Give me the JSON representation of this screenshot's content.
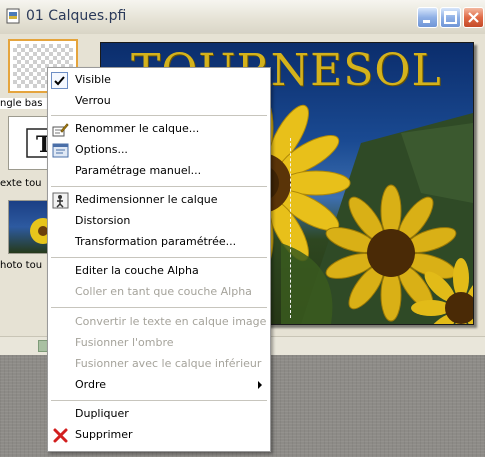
{
  "window": {
    "title": "01 Calques.pfi"
  },
  "layers": [
    {
      "label": "ngle bas"
    },
    {
      "label": "exte tou"
    },
    {
      "label": "hoto tou"
    }
  ],
  "image": {
    "title": "TOURNESOL"
  },
  "menu": {
    "items": [
      {
        "label": "Visible",
        "checked": true,
        "enabled": true
      },
      {
        "label": "Verrou",
        "enabled": true
      },
      {
        "label": "Renommer le calque...",
        "icon": "rename-icon",
        "enabled": true
      },
      {
        "label": "Options...",
        "icon": "options-icon",
        "enabled": true
      },
      {
        "label": "Paramétrage manuel...",
        "enabled": true
      },
      {
        "label": "Redimensionner le calque",
        "icon": "resize-icon",
        "enabled": true
      },
      {
        "label": "Distorsion",
        "enabled": true
      },
      {
        "label": "Transformation paramétrée...",
        "enabled": true
      },
      {
        "label": "Editer la couche Alpha",
        "enabled": true
      },
      {
        "label": "Coller en tant que couche Alpha",
        "enabled": false
      },
      {
        "label": "Convertir le texte en calque image",
        "enabled": false
      },
      {
        "label": "Fusionner l'ombre",
        "enabled": false
      },
      {
        "label": "Fusionner avec le calque inférieur",
        "enabled": false
      },
      {
        "label": "Ordre",
        "enabled": true,
        "submenu": true
      },
      {
        "label": "Dupliquer",
        "enabled": true
      },
      {
        "label": "Supprimer",
        "icon": "delete-icon",
        "enabled": true
      }
    ]
  },
  "colors": {
    "title_gold": "#d4b21c",
    "selection_orange": "#e5a43c",
    "delete_red": "#d21f1f"
  }
}
